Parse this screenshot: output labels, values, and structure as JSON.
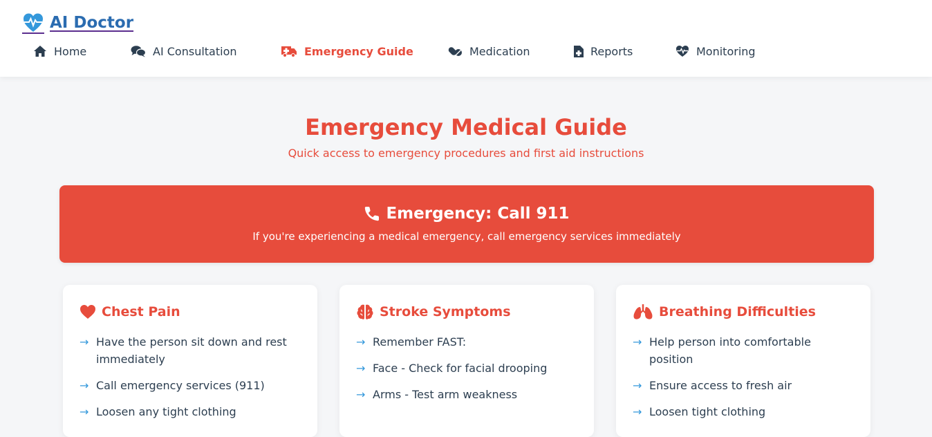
{
  "app": {
    "title": "AI Doctor",
    "colors": {
      "brand": "#2b6cb0",
      "accent": "#e74c3c",
      "arrow": "#3498db",
      "text": "#2c3e50"
    }
  },
  "nav": {
    "items": [
      {
        "label": "Home",
        "icon": "home-icon"
      },
      {
        "label": "AI Consultation",
        "icon": "chat-icon"
      },
      {
        "label": "Emergency Guide",
        "icon": "ambulance-icon",
        "active": true
      },
      {
        "label": "Medication",
        "icon": "pills-icon"
      },
      {
        "label": "Reports",
        "icon": "file-medical-icon"
      },
      {
        "label": "Monitoring",
        "icon": "heartbeat-icon"
      }
    ]
  },
  "page": {
    "title": "Emergency Medical Guide",
    "subtitle": "Quick access to emergency procedures and first aid instructions"
  },
  "banner": {
    "icon": "phone-icon",
    "title": "Emergency: Call 911",
    "text": "If you're experiencing a medical emergency, call emergency services immediately"
  },
  "cards": [
    {
      "title": "Chest Pain",
      "icon": "heart-icon",
      "steps": [
        "Have the person sit down and rest immediately",
        "Call emergency services (911)",
        "Loosen any tight clothing"
      ]
    },
    {
      "title": "Stroke Symptoms",
      "icon": "brain-icon",
      "steps": [
        "Remember FAST:",
        "Face - Check for facial drooping",
        "Arms - Test arm weakness"
      ]
    },
    {
      "title": "Breathing Difficulties",
      "icon": "lungs-icon",
      "steps": [
        "Help person into comfortable position",
        "Ensure access to fresh air",
        "Loosen tight clothing"
      ]
    }
  ],
  "arrow_glyph": "→"
}
